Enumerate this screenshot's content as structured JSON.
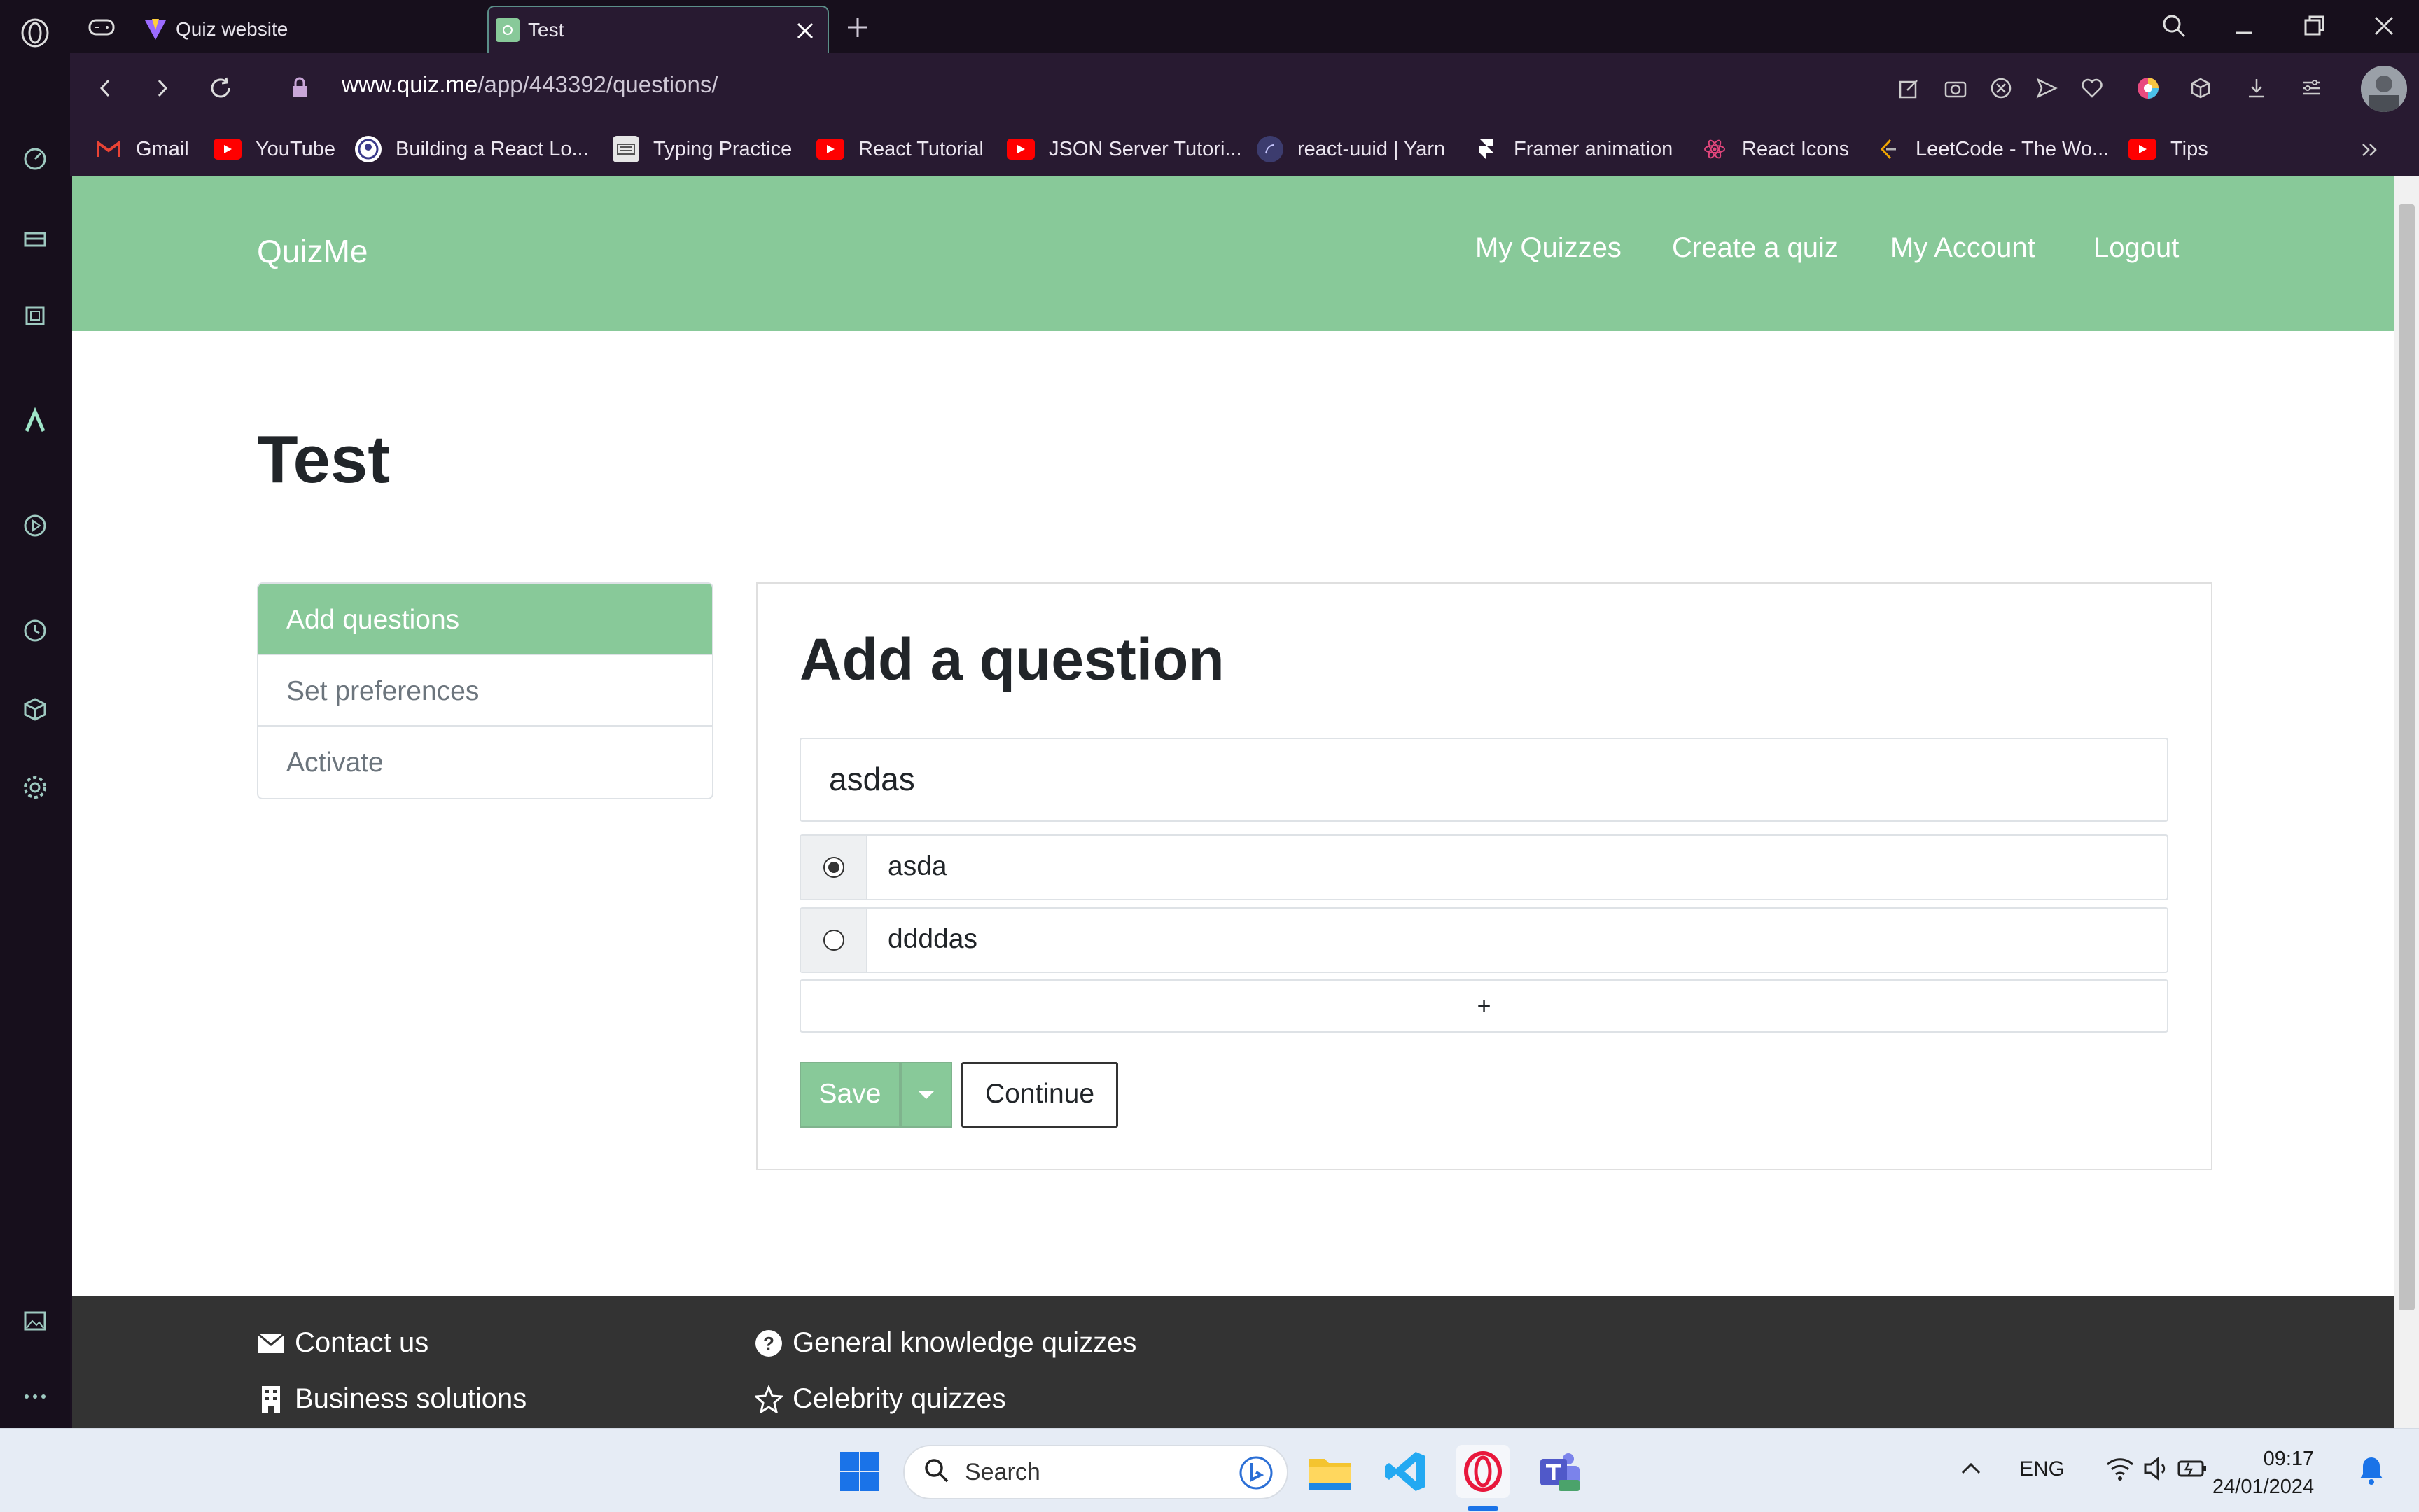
{
  "browser": {
    "tabs": [
      {
        "title": "Quiz website"
      },
      {
        "title": "Test"
      }
    ],
    "url_host": "www.quiz.me",
    "url_path": "/app/443392/questions/",
    "bookmarks": [
      {
        "label": "Gmail",
        "icon": "gmail-icon"
      },
      {
        "label": "YouTube",
        "icon": "youtube-icon"
      },
      {
        "label": "Building a React Lo...",
        "icon": "profile-icon"
      },
      {
        "label": "Typing Practice",
        "icon": "keyboard-icon"
      },
      {
        "label": "React Tutorial",
        "icon": "youtube-icon"
      },
      {
        "label": "JSON Server Tutori...",
        "icon": "youtube-icon"
      },
      {
        "label": "react-uuid | Yarn",
        "icon": "yarn-icon"
      },
      {
        "label": "Framer animation",
        "icon": "framer-icon"
      },
      {
        "label": "React Icons",
        "icon": "react-icon"
      },
      {
        "label": "LeetCode - The Wo...",
        "icon": "leetcode-icon"
      },
      {
        "label": "Tips",
        "icon": "youtube-icon"
      }
    ]
  },
  "site": {
    "brand": "QuizMe",
    "nav": [
      "My Quizzes",
      "Create a quiz",
      "My Account",
      "Logout"
    ],
    "accent": "#88c999"
  },
  "main": {
    "page_title": "Test",
    "steps": [
      {
        "label": "Add questions",
        "active": true
      },
      {
        "label": "Set preferences",
        "active": false
      },
      {
        "label": "Activate",
        "active": false
      }
    ],
    "card_title": "Add a question",
    "question_value": "asdas",
    "answers": [
      {
        "text": "asda",
        "selected": true
      },
      {
        "text": "ddddas",
        "selected": false
      }
    ],
    "add_answer_label": "+",
    "save_label": "Save",
    "continue_label": "Continue"
  },
  "footer": {
    "links": [
      {
        "label": "Contact us",
        "icon": "envelope-icon"
      },
      {
        "label": "Business solutions",
        "icon": "building-icon"
      },
      {
        "label": "General knowledge quizzes",
        "icon": "question-circle-icon"
      },
      {
        "label": "Celebrity quizzes",
        "icon": "star-icon"
      }
    ]
  },
  "taskbar": {
    "search_label": "Search",
    "language": "ENG",
    "time": "09:17",
    "date": "24/01/2024"
  }
}
